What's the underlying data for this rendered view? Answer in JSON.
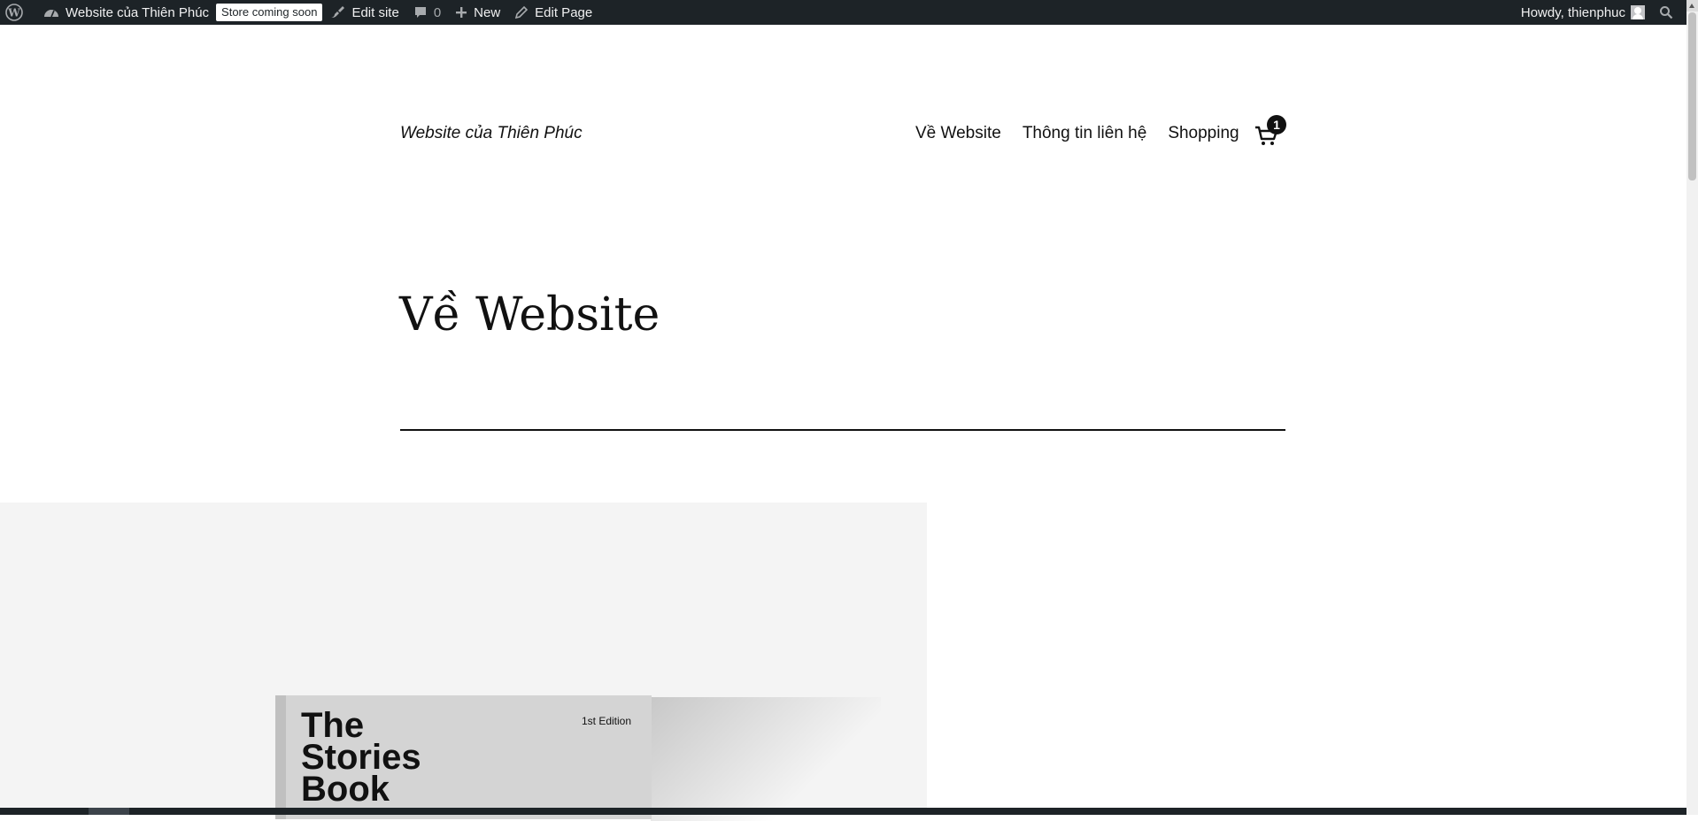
{
  "admin_bar": {
    "site_name": "Website của Thiên Phúc",
    "store_badge": "Store coming soon",
    "edit_site": "Edit site",
    "comments_count": "0",
    "new_label": "New",
    "edit_page": "Edit Page",
    "howdy": "Howdy, thienphuc"
  },
  "header": {
    "site_title": "Website của Thiên Phúc",
    "nav": [
      "Về Website",
      "Thông tin liên hệ",
      "Shopping"
    ],
    "cart_count": "1"
  },
  "main": {
    "page_title": "Về Website"
  },
  "book": {
    "title": "The\nStories\nBook",
    "edition": "1st Edition"
  },
  "colors": {
    "admin_bar_bg": "#1d2327",
    "text": "#111111",
    "cover_bg": "#f4f4f4"
  }
}
